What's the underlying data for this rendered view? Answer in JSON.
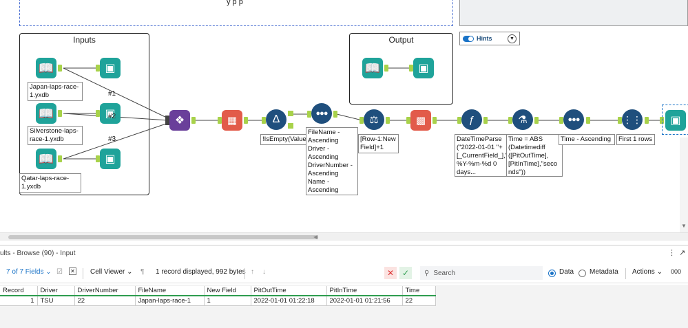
{
  "canvas": {
    "comment_partial": "y                           p    p",
    "containers": {
      "inputs_title": "Inputs",
      "output_title": "Output"
    },
    "hints_label": "Hints",
    "inputs": [
      {
        "label": "Japan-laps-race-1.yxdb"
      },
      {
        "label": "Silverstone-laps-race-1.yxdb"
      },
      {
        "label": "Qatar-laps-race-1.yxdb"
      }
    ],
    "union_labels": [
      "#1",
      "#2",
      "#3"
    ],
    "annotations": {
      "filter": "!IsEmpty(Value)",
      "sort1": "FileName - Ascending Driver - Ascending DriverNumber - Ascending Name - Ascending",
      "formula1": "[Row-1:New Field]+1",
      "datetime": "DateTimeParse (\"2022-01-01 \"+ [_CurrentField_],\" %Y-%m-%d 0 days...",
      "formula2": "Time = ABS (Datetimediff ([PitOutTime], [PitInTime],\"seco nds\"))",
      "sort2": "Time - Ascending",
      "sample": "First 1 rows"
    }
  },
  "results": {
    "title": "ults - Browse (90) - Input",
    "fields_label": "7 of 7 Fields",
    "cell_viewer_label": "Cell Viewer",
    "record_info": "1 record displayed, 992 bytes",
    "search_placeholder": "Search",
    "data_label": "Data",
    "metadata_label": "Metadata",
    "actions_label": "Actions",
    "more_label": "000"
  },
  "grid": {
    "columns": [
      "Record",
      "Driver",
      "DriverNumber",
      "FileName",
      "New Field",
      "PitOutTime",
      "PitInTime",
      "Time"
    ],
    "rows": [
      [
        "1",
        "TSU",
        "22",
        "Japan-laps-race-1",
        "1",
        "2022-01-01 01:22:18",
        "2022-01-01 01:21:56",
        "22"
      ]
    ]
  },
  "colors": {
    "tool_teal": "#1fa39a",
    "tool_navy": "#1f4f7d",
    "tool_red": "#e25b4a",
    "tool_purple": "#6a3f9a",
    "connector_green": "#a8d24a",
    "accent_blue": "#1a73c7",
    "grid_header_line": "#2e9d4f"
  }
}
